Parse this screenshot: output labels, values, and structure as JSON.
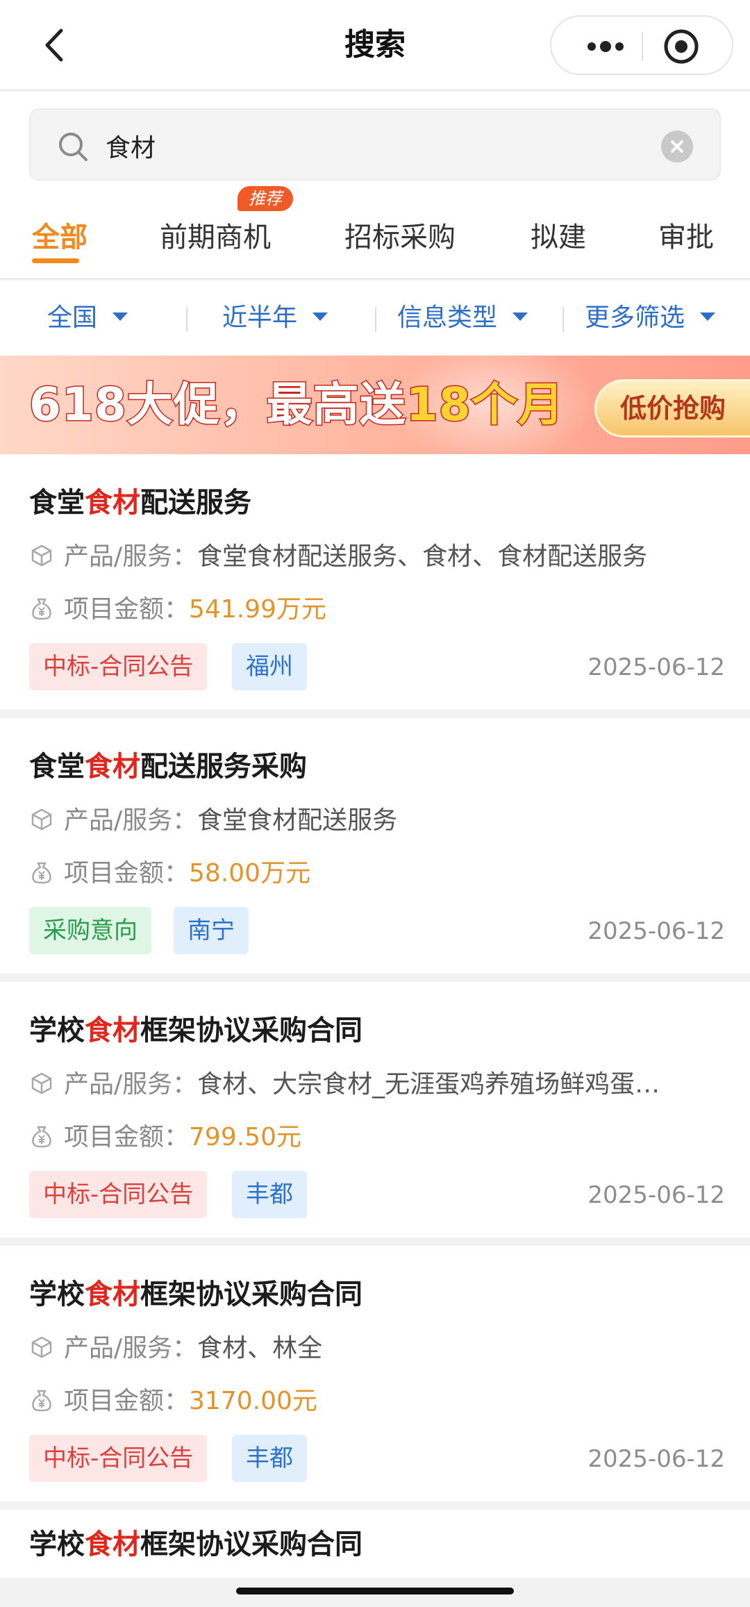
{
  "header": {
    "title": "搜索"
  },
  "search": {
    "value": "食材"
  },
  "tabs": [
    {
      "label": "全部",
      "active": true
    },
    {
      "label": "前期商机",
      "badge": "推荐"
    },
    {
      "label": "招标采购"
    },
    {
      "label": "拟建"
    },
    {
      "label": "审批"
    }
  ],
  "filters": [
    {
      "label": "全国"
    },
    {
      "label": "近半年"
    },
    {
      "label": "信息类型"
    },
    {
      "label": "更多筛选"
    }
  ],
  "banner": {
    "promo_prefix": "618大促，最高送",
    "promo_highlight": "18个月",
    "cta": "低价抢购"
  },
  "labels": {
    "product": "产品/服务：",
    "amount": "项目金额："
  },
  "results": [
    {
      "title_pre": "食堂",
      "title_kw": "食材",
      "title_post": "配送服务",
      "product": "食堂食材配送服务、食材、食材配送服务",
      "amount": "541.99万元",
      "type_tag": "中标-合同公告",
      "region": "福州",
      "date": "2025-06-12"
    },
    {
      "title_pre": "食堂",
      "title_kw": "食材",
      "title_post": "配送服务采购",
      "product": "食堂食材配送服务",
      "amount": "58.00万元",
      "type_tag": "采购意向",
      "region": "南宁",
      "date": "2025-06-12"
    },
    {
      "title_pre": "学校",
      "title_kw": "食材",
      "title_post": "框架协议采购合同",
      "product": "食材、大宗食材_无涯蛋鸡养殖场鲜鸡蛋…",
      "amount": "799.50元",
      "type_tag": "中标-合同公告",
      "region": "丰都",
      "date": "2025-06-12"
    },
    {
      "title_pre": "学校",
      "title_kw": "食材",
      "title_post": "框架协议采购合同",
      "product": "食材、林全",
      "amount": "3170.00元",
      "type_tag": "中标-合同公告",
      "region": "丰都",
      "date": "2025-06-12"
    },
    {
      "title_pre": "学校",
      "title_kw": "食材",
      "title_post": "框架协议采购合同"
    }
  ],
  "icons": {
    "back": "chevron-left-icon",
    "more": "more-dots-icon",
    "target": "target-icon",
    "search": "search-icon",
    "clear": "clear-icon",
    "product": "box-icon",
    "amount": "money-bag-icon"
  },
  "colors": {
    "accent": "#f08a1c",
    "keyword": "#e0261d",
    "filter": "#2d6fc6",
    "amount": "#e3932a"
  }
}
